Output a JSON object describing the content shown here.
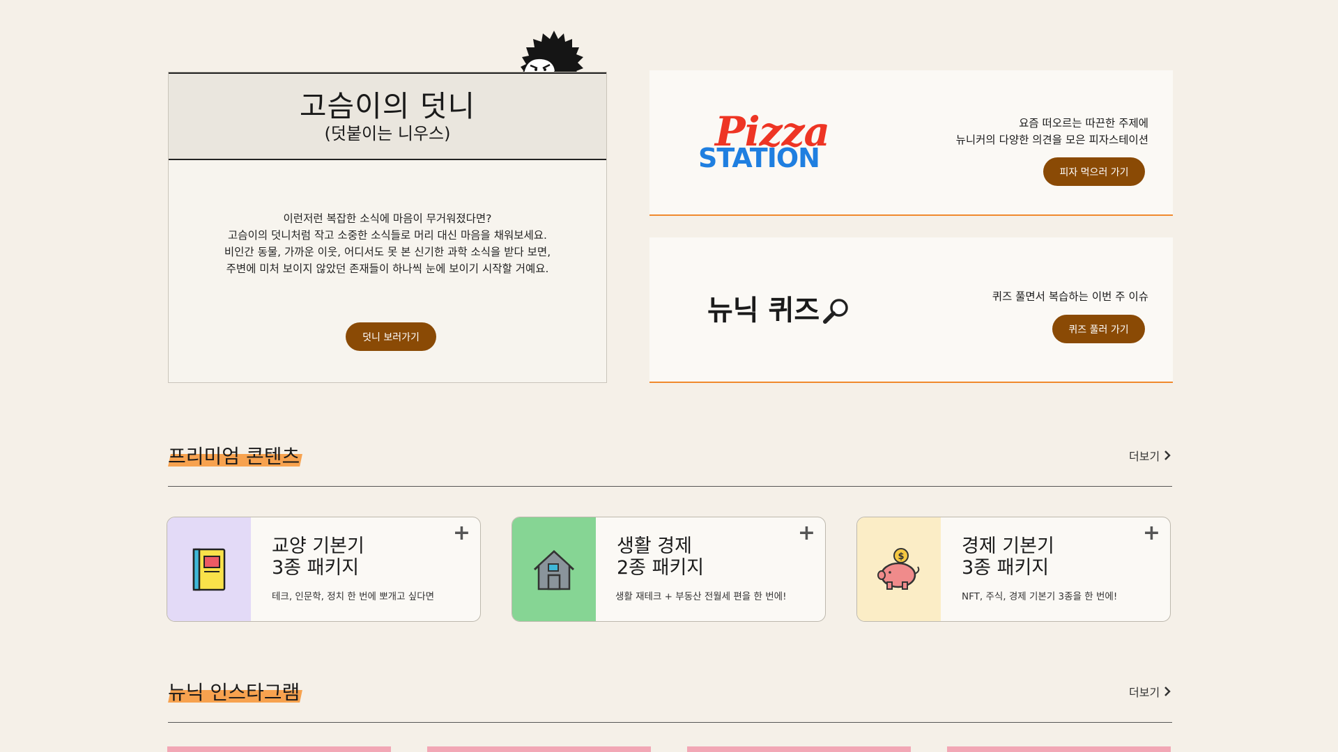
{
  "hedgehog": {
    "title": "고슴이의 덧니",
    "subtitle": "(덧붙이는 니우스)",
    "body_lines": [
      "이런저런 복잡한 소식에 마음이 무거워졌다면?",
      "고슴이의 덧니처럼 작고 소중한 소식들로 머리 대신 마음을 채워보세요.",
      "비인간 동물, 가까운 이웃, 어디서도 못 본 신기한 과학 소식을 받다 보면,",
      "주변에 미처 보이지 않았던 존재들이 하나씩 눈에 보이기 시작할 거예요."
    ],
    "button": "덧니 보러가기"
  },
  "pizza": {
    "logo_top": "Pizza",
    "logo_bottom": "STATION",
    "desc_lines": [
      "요즘 떠오르는 따끈한 주제에",
      "뉴니커의 다양한 의견을 모은 피자스테이션"
    ],
    "button": "피자 먹으러 가기",
    "colors": {
      "pizza": "#ee3524",
      "station": "#1f7fe0"
    }
  },
  "quiz": {
    "title": "뉴닉 퀴즈",
    "icon": "magnifier-icon",
    "desc": "퀴즈 풀면서 복습하는 이번 주 이슈",
    "button": "퀴즈 풀러 가기"
  },
  "premium": {
    "title": "프리미엄 콘텐츠",
    "more": "더보기",
    "cards": [
      {
        "title_line1": "교양 기본기",
        "title_line2": "3종 패키지",
        "desc": "테크, 인문학, 정치 한 번에 뽀개고 싶다면",
        "icon": "notebook-icon",
        "bg": "#e3daf7"
      },
      {
        "title_line1": "생활 경제",
        "title_line2": "2종 패키지",
        "desc": "생활 재테크 + 부동산 전월세 편을 한 번에!",
        "icon": "house-icon",
        "bg": "#86d594"
      },
      {
        "title_line1": "경제 기본기",
        "title_line2": "3종 패키지",
        "desc": "NFT, 주식, 경제 기본기 3종을 한 번에!",
        "icon": "piggy-bank-icon",
        "bg": "#fbedc6"
      }
    ],
    "plus": "+"
  },
  "instagram": {
    "title": "뉴닉 인스타그램",
    "more": "더보기"
  },
  "colors": {
    "accent_brown": "#8a4a05",
    "orange_highlight": "#f7a24f",
    "orange_line": "#f0892d",
    "page_bg": "#f5f0e8"
  }
}
